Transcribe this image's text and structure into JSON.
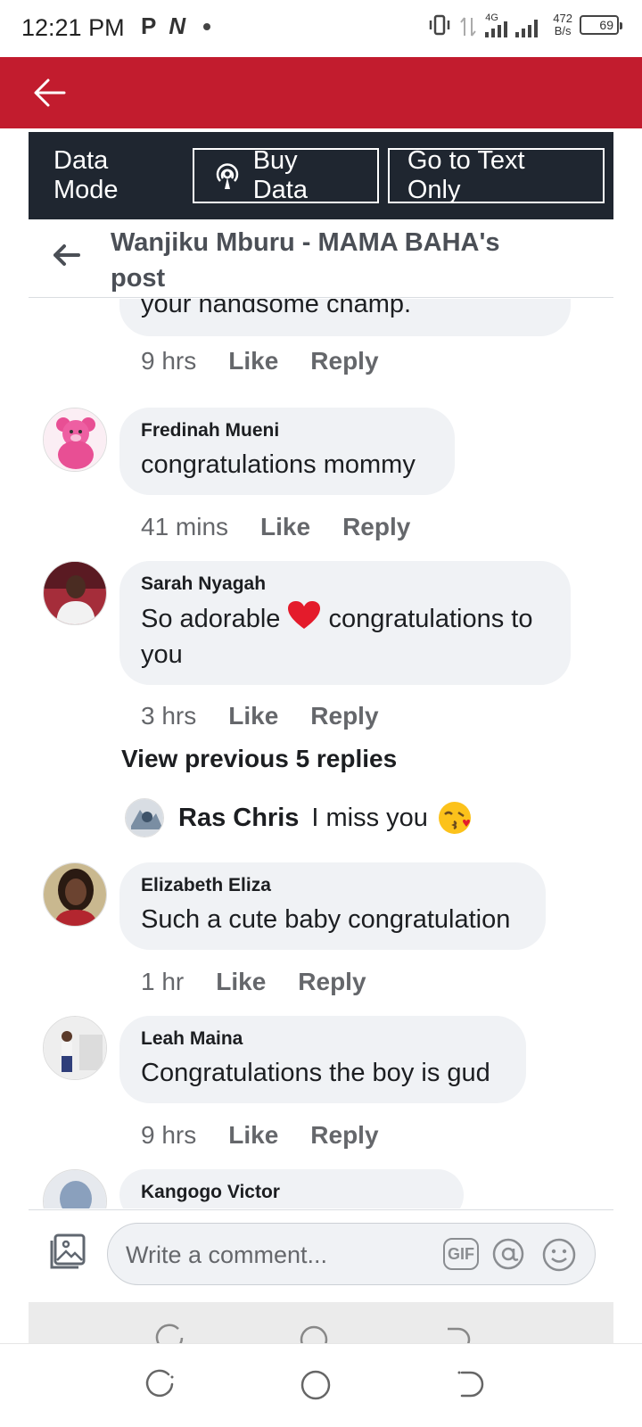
{
  "status_bar": {
    "time": "12:21 PM",
    "left_icons": [
      "P",
      "N"
    ],
    "network_label": "4G",
    "speed_value": "472",
    "speed_unit": "B/s",
    "battery": "69"
  },
  "app_bar": {
    "back_icon": "arrow-left-icon",
    "color": "#c21c2e"
  },
  "data_bar": {
    "mode_label": "Data Mode",
    "buy_data_label": "Buy Data",
    "text_only_label": "Go to Text Only"
  },
  "post_header": {
    "title": "Wanjiku Mburu - MAMA BAHA's post"
  },
  "comments": [
    {
      "text": "your handsome champ.",
      "time": "9 hrs",
      "like": "Like",
      "reply": "Reply"
    },
    {
      "name": "Fredinah Mueni",
      "text": "congratulations mommy",
      "time": "41 mins",
      "like": "Like",
      "reply": "Reply"
    },
    {
      "name": "Sarah Nyagah",
      "text_before": "So adorable",
      "text_after": "congratulations to you",
      "time": "3 hrs",
      "like": "Like",
      "reply": "Reply"
    },
    {
      "name": "Elizabeth Eliza",
      "text": "Such a cute baby congratulation",
      "time": "1 hr",
      "like": "Like",
      "reply": "Reply"
    },
    {
      "name": "Leah Maina",
      "text": "Congratulations the boy is gud",
      "time": "9 hrs",
      "like": "Like",
      "reply": "Reply"
    },
    {
      "name": "Kangogo Victor"
    }
  ],
  "view_previous": "View previous 5 replies",
  "reply_preview": {
    "name": "Ras Chris",
    "text": "I miss you"
  },
  "composer": {
    "placeholder": "Write a comment...",
    "gif_label": "GIF"
  }
}
